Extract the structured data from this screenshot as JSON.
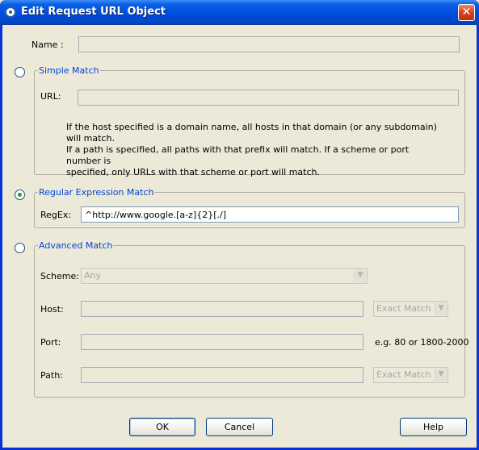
{
  "window": {
    "title": "Edit Request URL Object",
    "close_glyph": "✕"
  },
  "name": {
    "label": "Name :",
    "value": ""
  },
  "simple_match": {
    "legend": "Simple Match",
    "url_label": "URL:",
    "url_value": "",
    "description": [
      "If the host specified is a domain name, all hosts in that domain (or any subdomain) will match.",
      "If a path is specified, all paths with that prefix will match. If a scheme or port number is",
      "specified, only URLs with that scheme or port will match."
    ],
    "selected": false
  },
  "regex_match": {
    "legend": "Regular Expression Match",
    "regex_label": "RegEx:",
    "regex_value": "^http://www.google.[a-z]{2}[./]",
    "selected": true
  },
  "advanced_match": {
    "legend": "Advanced Match",
    "selected": false,
    "scheme_label": "Scheme:",
    "scheme_value": "Any",
    "host_label": "Host:",
    "host_value": "",
    "host_mode": "Exact Match",
    "port_label": "Port:",
    "port_value": "",
    "port_hint": "e.g. 80 or 1800-2000",
    "path_label": "Path:",
    "path_value": "",
    "path_mode": "Exact Match"
  },
  "buttons": {
    "ok": "OK",
    "cancel": "Cancel",
    "help": "Help"
  },
  "colors": {
    "title_bar": "#0050de",
    "legend_text": "#0046d5",
    "dialog_bg": "#ece9d8"
  },
  "icons": {
    "title": "gear-icon",
    "close": "close-icon",
    "dropdown": "chevron-down-icon"
  }
}
